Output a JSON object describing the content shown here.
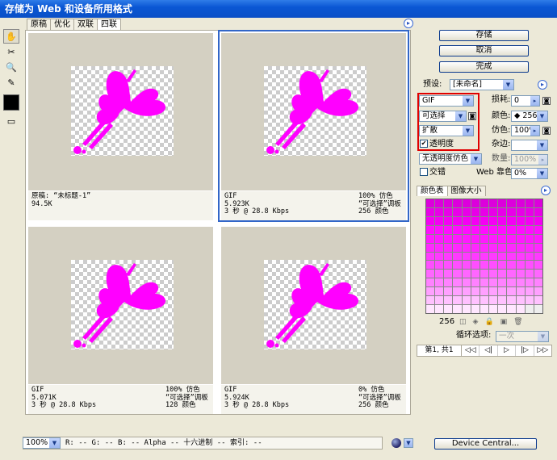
{
  "window": {
    "title": "存储为 Web 和设备所用格式"
  },
  "tabs": [
    "原稿",
    "优化",
    "双联",
    "四联"
  ],
  "active_tab": 3,
  "panes": [
    {
      "left": [
        "原稿: “未标题-1”",
        "94.5K",
        ""
      ],
      "right": [
        "",
        "",
        ""
      ]
    },
    {
      "left": [
        "GIF",
        "5.923K",
        "3 秒 @ 28.8 Kbps"
      ],
      "right": [
        "100% 仿色",
        "“可选择”调板",
        "256 颜色"
      ]
    },
    {
      "left": [
        "GIF",
        "5.071K",
        "3 秒 @ 28.8 Kbps"
      ],
      "right": [
        "100% 仿色",
        "“可选择”调板",
        "128 颜色"
      ]
    },
    {
      "left": [
        "GIF",
        "5.924K",
        "3 秒 @ 28.8 Kbps"
      ],
      "right": [
        "0% 仿色",
        "“可选择”调板",
        "256 颜色"
      ]
    }
  ],
  "buttons": {
    "save": "存储",
    "cancel": "取消",
    "done": "完成",
    "device_central": "Device Central..."
  },
  "settings": {
    "preset_label": "预设:",
    "preset_value": "[未命名]",
    "format": "GIF",
    "lossy_label": "损耗:",
    "lossy_value": "0",
    "palette": "可选择",
    "colors_label": "颜色:",
    "colors_value": "256",
    "dither_algo": "扩散",
    "dither_label": "仿色:",
    "dither_value": "100%",
    "transparency_label": "透明度",
    "transparency_checked": true,
    "matte_label": "杂边:",
    "matte_value": "",
    "trans_dither": "无透明度仿色",
    "amount_label": "数量:",
    "amount_value": "100%",
    "interlaced_label": "交错",
    "interlaced_checked": false,
    "websnap_label": "Web 靠色:",
    "websnap_value": "0%"
  },
  "color_tabs": [
    "颜色表",
    "图像大小"
  ],
  "color_table": {
    "count": "256",
    "accent": "#ff00ff"
  },
  "animation": {
    "loop_label": "循环选项:",
    "loop_value": "一次",
    "frame_label": "第1, 共1"
  },
  "status": {
    "zoom": "100%",
    "readout": "R: --  G: --  B: --  Alpha --  十六进制  --  索引: --"
  },
  "icons": [
    "hand-icon",
    "slice-select-icon",
    "zoom-icon",
    "eyedropper-icon",
    "toggle-slices-icon",
    "menu-arrow-icon",
    "browser-preview-icon"
  ]
}
